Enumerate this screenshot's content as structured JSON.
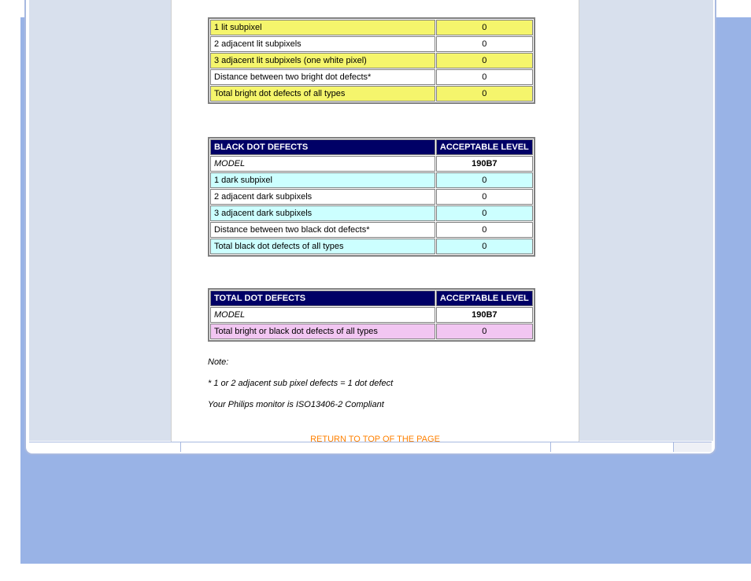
{
  "tables": {
    "bright": {
      "rows": [
        {
          "label": "1 lit subpixel",
          "value": "0",
          "shade": "yellow"
        },
        {
          "label": "2 adjacent lit subpixels",
          "value": "0",
          "shade": ""
        },
        {
          "label": "3 adjacent lit subpixels (one white pixel)",
          "value": "0",
          "shade": "yellow"
        },
        {
          "label": "Distance between two bright dot defects*",
          "value": "0",
          "shade": ""
        },
        {
          "label": "Total bright dot defects of all types",
          "value": "0",
          "shade": "yellow"
        }
      ]
    },
    "black": {
      "header1": "BLACK DOT DEFECTS",
      "header2": "ACCEPTABLE LEVEL",
      "model_label": "MODEL",
      "model_value": "190B7",
      "rows": [
        {
          "label": "1 dark subpixel",
          "value": "0",
          "shade": "cyan"
        },
        {
          "label": "2 adjacent dark subpixels",
          "value": "0",
          "shade": ""
        },
        {
          "label": "3 adjacent dark subpixels",
          "value": "0",
          "shade": "cyan"
        },
        {
          "label": "Distance between two black dot defects*",
          "value": "0",
          "shade": ""
        },
        {
          "label": "Total black dot defects of all types",
          "value": "0",
          "shade": "cyan"
        }
      ]
    },
    "total": {
      "header1": "TOTAL DOT DEFECTS",
      "header2": "ACCEPTABLE LEVEL",
      "model_label": "MODEL",
      "model_value": "190B7",
      "rows": [
        {
          "label": "Total bright or black dot defects of all types",
          "value": "0",
          "shade": "pink"
        }
      ]
    }
  },
  "notes": {
    "note": "Note:",
    "line1": "* 1 or 2 adjacent sub pixel defects = 1 dot defect",
    "line2": "Your Philips monitor is ISO13406-2 Compliant"
  },
  "return_link": "RETURN TO TOP OF THE PAGE"
}
